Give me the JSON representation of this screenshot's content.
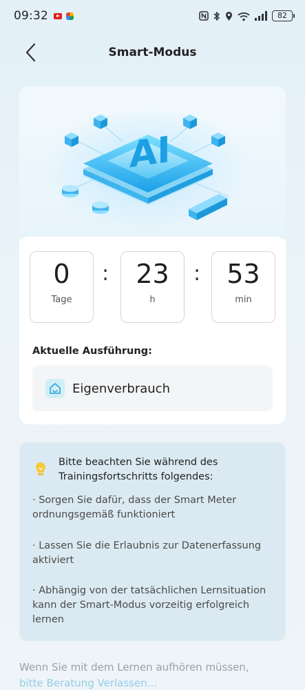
{
  "status_bar": {
    "time": "09:32",
    "battery": "82",
    "icons": [
      "youtube-icon",
      "app-icon",
      "nfc-icon",
      "bluetooth-icon",
      "location-icon",
      "wifi-icon",
      "signal-icon",
      "battery-icon"
    ]
  },
  "header": {
    "title": "Smart-Modus",
    "back_icon": "chevron-left-icon"
  },
  "hero": {
    "badge_text": "AI"
  },
  "timer": {
    "days_value": "0",
    "days_unit": "Tage",
    "hours_value": "23",
    "hours_unit": "h",
    "minutes_value": "53",
    "minutes_unit": "min",
    "separator": ":"
  },
  "execution": {
    "label": "Aktuelle Ausführung:",
    "mode": "Eigenverbrauch",
    "mode_icon": "home-icon"
  },
  "hint": {
    "icon": "lightbulb-icon",
    "title": "Bitte beachten Sie während des Trainingsfortschritts folgendes:",
    "items": [
      "· Sorgen Sie dafür, dass der Smart Meter ordnungsgemäß funktioniert",
      "· Lassen Sie die Erlaubnis zur Datenerfassung aktiviert",
      "· Abhängig von der tatsächlichen Lernsituation kann der Smart-Modus vorzeitig erfolgreich lernen"
    ]
  },
  "footer": {
    "text": "Wenn Sie mit dem Lernen aufhören müssen,",
    "link": "bitte Beratung Verlassen..."
  },
  "colors": {
    "accent": "#3aa6d8",
    "hint_bg": "#dbeaf2",
    "page_bg": "#e6f1f7"
  }
}
